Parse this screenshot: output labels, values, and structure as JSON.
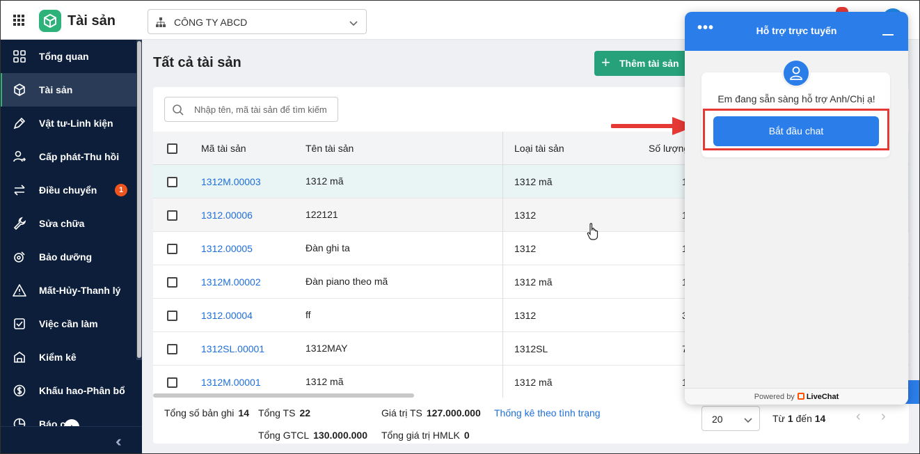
{
  "header": {
    "app_title": "Tài sản",
    "company": "CÔNG TY ABCD"
  },
  "sidebar": {
    "items": [
      {
        "label": "Tổng quan",
        "icon": "dashboard-icon"
      },
      {
        "label": "Tài sản",
        "icon": "cube-icon",
        "active": true
      },
      {
        "label": "Vật tư-Linh kiện",
        "icon": "pen-icon"
      },
      {
        "label": "Cấp phát-Thu hồi",
        "icon": "user-transfer-icon"
      },
      {
        "label": "Điều chuyển",
        "icon": "swap-icon",
        "badge": "1"
      },
      {
        "label": "Sửa chữa",
        "icon": "wrench-icon"
      },
      {
        "label": "Bảo dưỡng",
        "icon": "maintenance-icon"
      },
      {
        "label": "Mất-Hủy-Thanh lý",
        "icon": "warning-icon"
      },
      {
        "label": "Việc cần làm",
        "icon": "checkbox-icon"
      },
      {
        "label": "Kiểm kê",
        "icon": "inventory-icon"
      },
      {
        "label": "Khấu hao-Phân bổ",
        "icon": "dollar-icon"
      },
      {
        "label": "Báo c",
        "icon": "pie-chart-icon"
      }
    ]
  },
  "main": {
    "title": "Tất cả tài sản",
    "add_button": "Thêm tài sản",
    "search_placeholder": "Nhập tên, mã tài sản để tìm kiếm",
    "columns": [
      "Mã tài sản",
      "Tên tài sản",
      "Loại tài sản",
      "Số lượng"
    ],
    "rows": [
      {
        "code": "1312M.00003",
        "name": "1312 mã",
        "type": "1312 mã",
        "qty": "1"
      },
      {
        "code": "1312.00006",
        "name": "122121",
        "type": "1312",
        "qty": "1"
      },
      {
        "code": "1312.00005",
        "name": "Đàn ghi ta",
        "type": "1312",
        "qty": "1"
      },
      {
        "code": "1312M.00002",
        "name": "Đàn piano theo mã",
        "type": "1312 mã",
        "qty": "1"
      },
      {
        "code": "1312.00004",
        "name": "ff",
        "type": "1312",
        "qty": "3"
      },
      {
        "code": "1312SL.00001",
        "name": "1312MAY",
        "type": "1312SL",
        "qty": "7"
      },
      {
        "code": "1312M.00001",
        "name": "1312 mã",
        "type": "1312 mã",
        "qty": "1"
      }
    ],
    "footer": {
      "total_records_label": "Tổng số bản ghi",
      "total_records": "14",
      "total_ts_label": "Tổng TS",
      "total_ts": "22",
      "value_ts_label": "Giá trị TS",
      "value_ts": "127.000.000",
      "stats_link": "Thống kê theo tình trạng",
      "gtcl_label": "Tổng GTCL",
      "gtcl": "130.000.000",
      "hmlk_label": "Tổng giá trị HMLK",
      "hmlk": "0",
      "page_size": "20",
      "from_label": "Từ",
      "from": "1",
      "to_label": "đến",
      "to": "14"
    }
  },
  "chat": {
    "title": "Hỗ trợ trực tuyến",
    "message": "Em đang sẵn sàng hỗ trợ Anh/Chị ạ!",
    "start_button": "Bắt đầu chat",
    "powered_by": "Powered by",
    "brand": "LiveChat"
  },
  "colors": {
    "sidebar_bg": "#0c1e3a",
    "accent_green": "#26a17a",
    "link_blue": "#1e6fd9",
    "chat_blue": "#2b7de9",
    "highlight_red": "#e53935"
  }
}
